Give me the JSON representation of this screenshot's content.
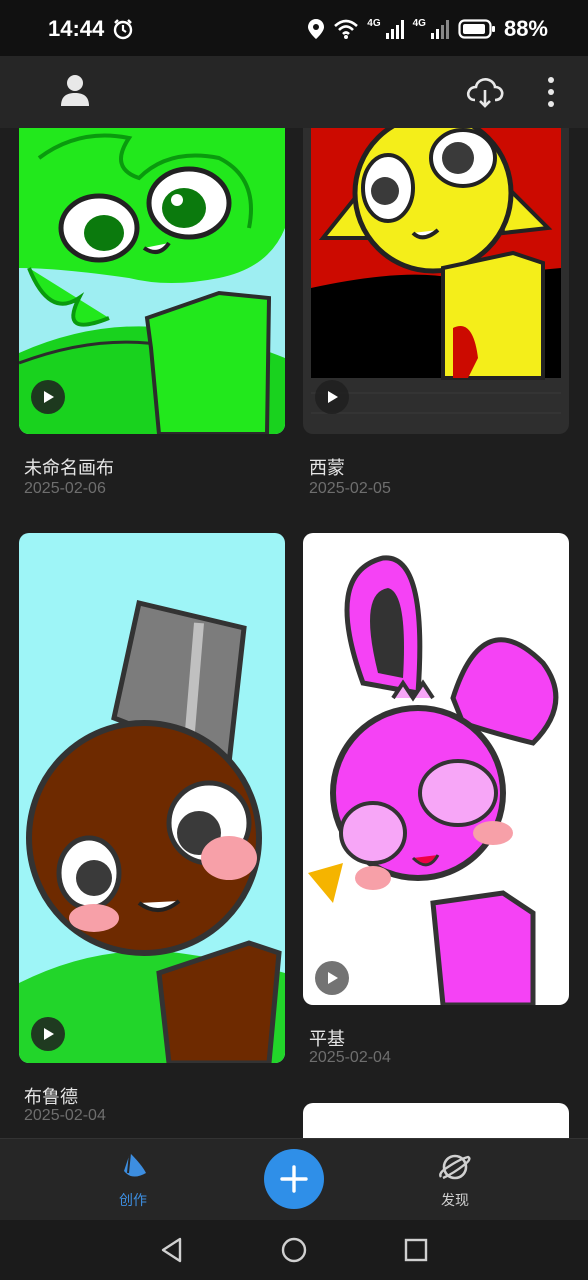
{
  "status_bar": {
    "time": "14:44",
    "network_1": "4G",
    "network_2": "4G",
    "battery": "88%"
  },
  "header": {
    "profile_icon": "person-icon",
    "cloud_icon": "cloud-sync-icon",
    "menu_icon": "more-vertical-icon"
  },
  "artworks": [
    {
      "title": "未命名画布",
      "date": "2025-02-06"
    },
    {
      "title": "西蒙",
      "date": "2025-02-05"
    },
    {
      "title": "布鲁德",
      "date": "2025-02-04"
    },
    {
      "title": "平基",
      "date": "2025-02-04"
    }
  ],
  "bottom_nav": {
    "create_label": "创作",
    "discover_label": "发现",
    "active_color": "#3d8ee0",
    "add_color": "#2f8fe8"
  },
  "colors": {
    "background": "#1e1e1e",
    "header": "#262626"
  }
}
